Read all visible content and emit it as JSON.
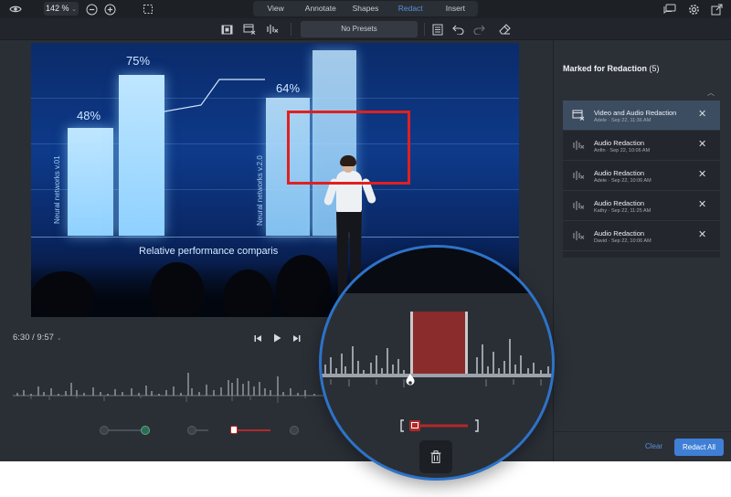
{
  "toolbar": {
    "zoom": "142 %",
    "tabs": [
      {
        "label": "View",
        "active": false
      },
      {
        "label": "Annotate",
        "active": false
      },
      {
        "label": "Shapes",
        "active": false
      },
      {
        "label": "Redact",
        "active": true
      },
      {
        "label": "Insert",
        "active": false
      }
    ],
    "presets": "No Presets"
  },
  "video": {
    "bars": [
      {
        "label": "48%",
        "value": 48
      },
      {
        "label": "75%",
        "value": 75
      },
      {
        "label": "64%",
        "value": 64
      },
      {
        "label": "",
        "value": 90
      }
    ],
    "slide_caption": "Relative performance comparis",
    "vertical_text_left": "Neural networks v.01",
    "vertical_text_mid": "Neural networks v.2.0"
  },
  "panel": {
    "title": "Marked for Redaction",
    "count": "(5)",
    "items": [
      {
        "name": "Video and Audio Redaction",
        "meta": "Adele · Sep 22, 11:36 AM",
        "kind": "video-audio",
        "selected": true
      },
      {
        "name": "Audio Redaction",
        "meta": "Anfin · Sep 22, 10:06 AM",
        "kind": "audio",
        "selected": false
      },
      {
        "name": "Audio Redaction",
        "meta": "Adele · Sep 22, 10:06 AM",
        "kind": "audio",
        "selected": false
      },
      {
        "name": "Audio Redaction",
        "meta": "Kathy · Sep 22, 11:25 AM",
        "kind": "audio",
        "selected": false
      },
      {
        "name": "Audio Redaction",
        "meta": "David · Sep 22, 10:06 AM",
        "kind": "audio",
        "selected": false
      }
    ],
    "clear_label": "Clear",
    "redact_all_label": "Redact All"
  },
  "timeline": {
    "time": "6:30 / 9:57"
  },
  "colors": {
    "accent": "#3f7fd6",
    "redaction": "#e0201f",
    "magnifier_border": "#2d73c9"
  }
}
